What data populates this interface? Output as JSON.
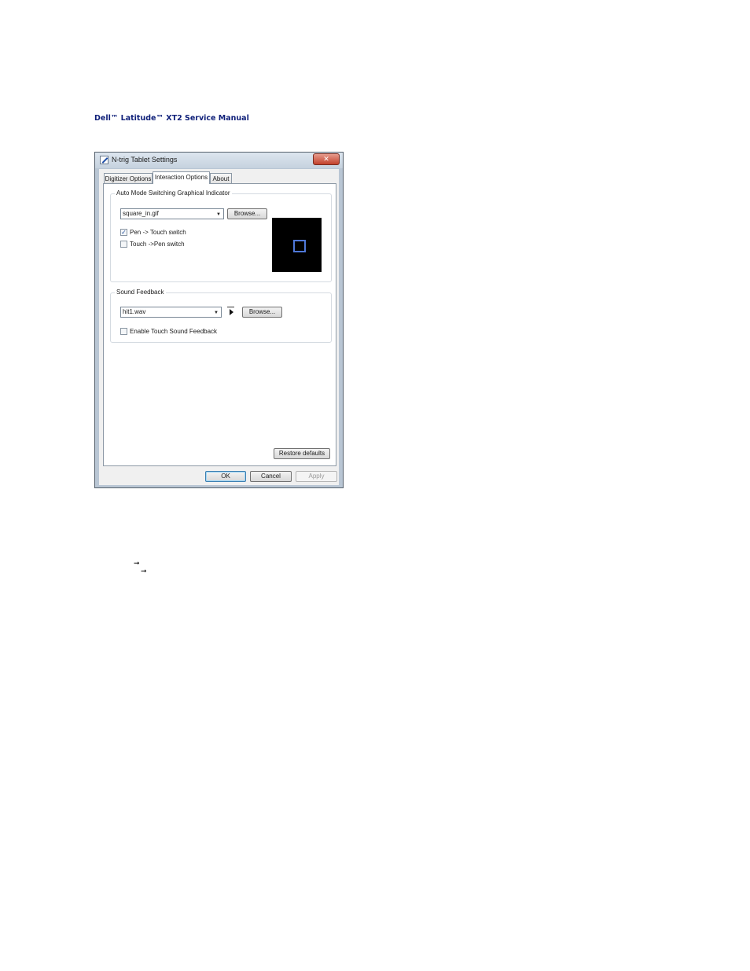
{
  "document": {
    "header": "Dell™ Latitude™ XT2 Service Manual",
    "arrow_glyphs": [
      "➞",
      "➞"
    ]
  },
  "window": {
    "title": "N-trig Tablet Settings",
    "close_label": "✕",
    "tabs": [
      {
        "label": "Digitizer Options",
        "active": false
      },
      {
        "label": "Interaction Options",
        "active": true
      },
      {
        "label": "About",
        "active": false
      }
    ],
    "auto_mode": {
      "group_label": "Auto Mode Switching Graphical Indicator",
      "indicator_value": "square_in.gif",
      "browse_label": "Browse...",
      "pen_touch": {
        "label": "Pen -> Touch switch",
        "checked": true,
        "check_glyph": "✓"
      },
      "touch_pen": {
        "label": "Touch ->Pen switch",
        "checked": false
      }
    },
    "sound": {
      "group_label": "Sound Feedback",
      "sound_value": "hit1.wav",
      "browse_label": "Browse...",
      "enable_touch": {
        "label": "Enable Touch Sound Feedback",
        "checked": false
      }
    },
    "restore_label": "Restore defaults",
    "ok_label": "OK",
    "cancel_label": "Cancel",
    "apply_label": "Apply"
  }
}
